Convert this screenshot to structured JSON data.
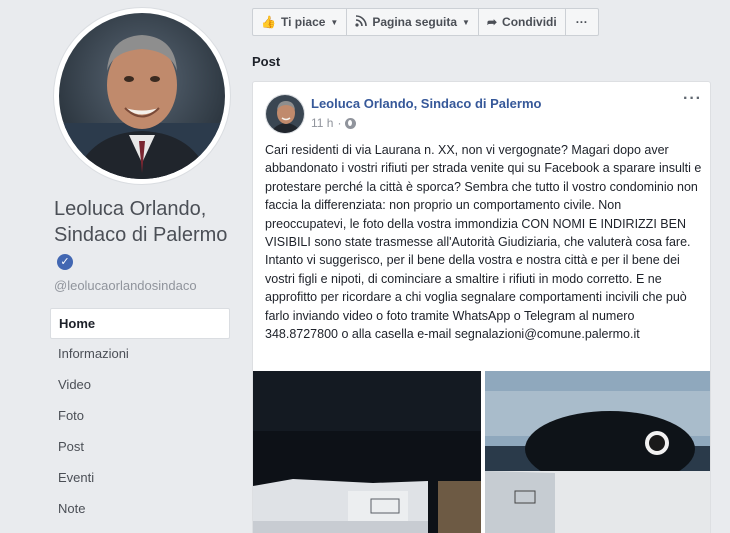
{
  "sidebar": {
    "page_name": "Leoluca Orlando, Sindaco di Palermo",
    "handle": "@leolucaorlandosindaco",
    "nav": [
      {
        "label": "Home"
      },
      {
        "label": "Informazioni"
      },
      {
        "label": "Video"
      },
      {
        "label": "Foto"
      },
      {
        "label": "Post"
      },
      {
        "label": "Eventi"
      },
      {
        "label": "Note"
      }
    ]
  },
  "actions": {
    "like": "Ti piace",
    "follow": "Pagina seguita",
    "share": "Condividi",
    "more": "···"
  },
  "section_title": "Post",
  "post": {
    "author": "Leoluca Orlando, Sindaco di Palermo",
    "time": "11 h",
    "menu": "···",
    "text": "Cari residenti di via Laurana n. XX, non vi vergognate? Magari dopo aver abbandonato i vostri rifiuti per strada venite qui su Facebook a sparare insulti e protestare perché la città è sporca? Sembra che tutto il vostro condominio non faccia la differenziata: non proprio un comportamento civile. Non preoccupatevi, le foto della vostra immondizia CON NOMI E INDIRIZZI BEN VISIBILI sono state trasmesse all'Autorità Giudiziaria, che valuterà cosa fare. Intanto vi suggerisco, per il bene della vostra e nostra città e per il bene dei vostri figli e nipoti, di cominciare a smaltire i rifiuti in modo corretto. E ne approfitto per ricordare a chi voglia segnalare comportamenti incivili che può farlo inviando video o foto tramite WhatsApp o Telegram al numero 348.8727800 o alla casella e-mail segnalazioni@comune.palermo.it"
  },
  "colors": {
    "accent": "#4267b2",
    "link": "#365899",
    "background": "#e9ebee"
  }
}
